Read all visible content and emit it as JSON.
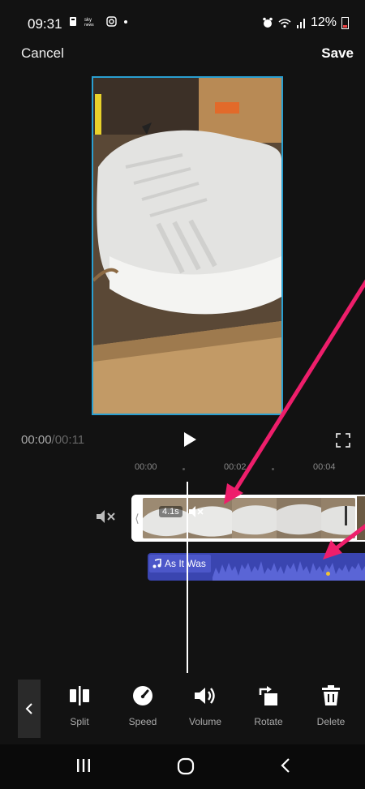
{
  "status_bar": {
    "time": "09:31",
    "left_icons": [
      "notification-icon",
      "sky-news-icon",
      "instagram-icon",
      "dot-icon"
    ],
    "battery_percent": "12%"
  },
  "header": {
    "cancel_label": "Cancel",
    "save_label": "Save"
  },
  "playback": {
    "current_time": "00:00",
    "separator": "/",
    "total_time": "00:11"
  },
  "ruler": {
    "ticks": [
      "00:00",
      "00:02",
      "00:04"
    ]
  },
  "timeline": {
    "clip_duration": "4.1s",
    "audio_title": "As It Was"
  },
  "toolbar": {
    "items": [
      {
        "label": "Split",
        "icon": "split-icon"
      },
      {
        "label": "Speed",
        "icon": "speed-icon"
      },
      {
        "label": "Volume",
        "icon": "volume-icon"
      },
      {
        "label": "Rotate",
        "icon": "rotate-icon"
      },
      {
        "label": "Delete",
        "icon": "delete-icon"
      }
    ]
  },
  "colors": {
    "background": "#121212",
    "preview_border": "#2a9fd0",
    "audio_track": "#3a45b0",
    "annotation_arrow": "#ee1e6b"
  }
}
